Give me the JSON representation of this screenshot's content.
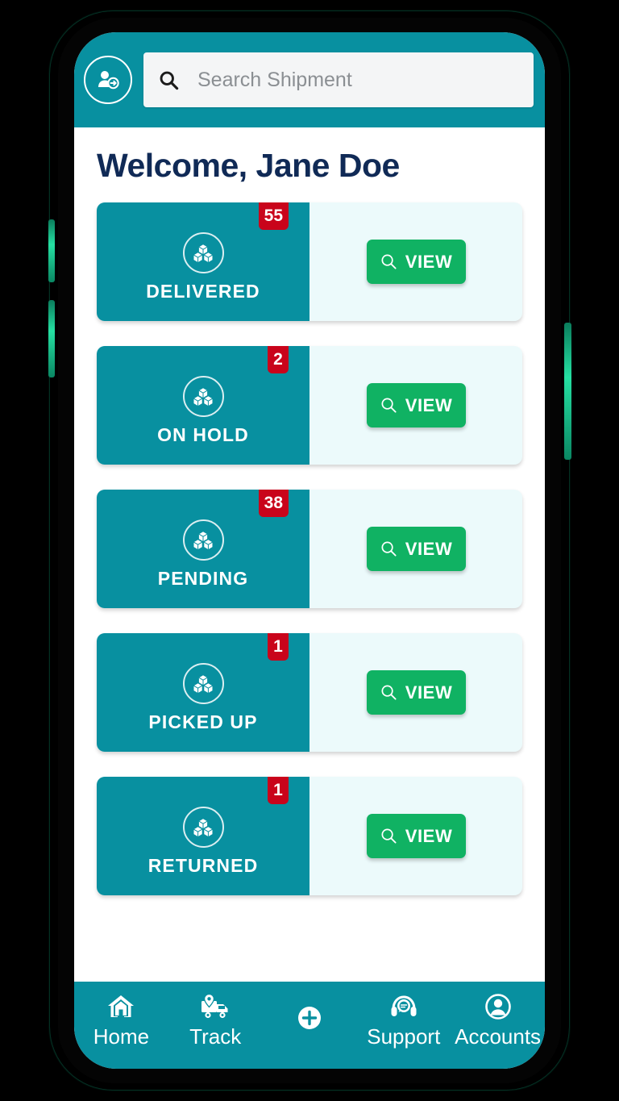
{
  "app": {
    "accent_teal": "#0890A0",
    "accent_green": "#10B263",
    "badge_red": "#C9041B",
    "title_navy": "#102A56",
    "card_right_bg": "#ECFAFB"
  },
  "header": {
    "profile_icon": "user-logout-icon",
    "search": {
      "icon": "search-icon",
      "placeholder": "Search Shipment",
      "value": ""
    }
  },
  "main": {
    "greeting": "Welcome, Jane Doe",
    "cards": [
      {
        "label": "DELIVERED",
        "badge": "55",
        "icon": "boxes-icon",
        "view_label": "VIEW"
      },
      {
        "label": "ON HOLD",
        "badge": "2",
        "icon": "boxes-icon",
        "view_label": "VIEW"
      },
      {
        "label": "PENDING",
        "badge": "38",
        "icon": "boxes-icon",
        "view_label": "VIEW"
      },
      {
        "label": "PICKED UP",
        "badge": "1",
        "icon": "boxes-icon",
        "view_label": "VIEW"
      },
      {
        "label": "RETURNED",
        "badge": "1",
        "icon": "boxes-icon",
        "view_label": "VIEW"
      }
    ]
  },
  "bottom_nav": {
    "items": [
      {
        "label": "Home",
        "icon": "home-icon"
      },
      {
        "label": "Track",
        "icon": "delivery-truck-icon"
      },
      {
        "label": "",
        "icon": "plus-circle-icon"
      },
      {
        "label": "Support",
        "icon": "headset-support-icon"
      },
      {
        "label": "Accounts",
        "icon": "user-account-icon"
      }
    ]
  }
}
